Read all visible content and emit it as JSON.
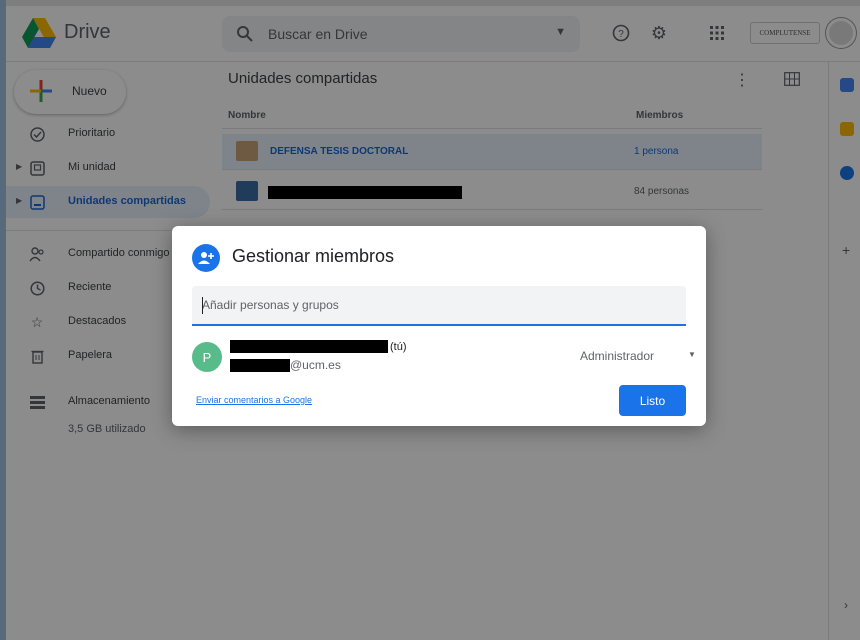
{
  "topbar": {
    "brand": "Drive",
    "search_placeholder": "Buscar en Drive",
    "org_logo_text": "COMPLUTENSE"
  },
  "sidebar": {
    "new_label": "Nuevo",
    "items": [
      {
        "label": "Prioritario",
        "icon": "check-circle-icon"
      },
      {
        "label": "Mi unidad",
        "icon": "my-drive-icon"
      },
      {
        "label": "Unidades compartidas",
        "icon": "shared-drives-icon",
        "active": true
      },
      {
        "label": "Compartido conmigo",
        "icon": "people-icon"
      },
      {
        "label": "Reciente",
        "icon": "clock-icon"
      },
      {
        "label": "Destacados",
        "icon": "star-icon"
      },
      {
        "label": "Papelera",
        "icon": "trash-icon"
      },
      {
        "label": "Almacenamiento",
        "icon": "storage-icon"
      }
    ],
    "storage_used": "3,5 GB utilizado"
  },
  "main": {
    "title": "Unidades compartidas",
    "columns": {
      "name": "Nombre",
      "members": "Miembros"
    },
    "rows": [
      {
        "name": "DEFENSA TESIS DOCTORAL",
        "members": "1 persona"
      },
      {
        "name": "",
        "members": "84 personas"
      }
    ]
  },
  "dialog": {
    "title": "Gestionar miembros",
    "add_placeholder": "Añadir personas y grupos",
    "member": {
      "initial": "P",
      "you_tag": "(tú)",
      "email_suffix": "@ucm.es",
      "role": "Administrador"
    },
    "feedback_link": "Enviar comentarios a Google",
    "done_label": "Listo"
  },
  "colors": {
    "accent": "#1a73e8",
    "selected_row": "#e8f0fe",
    "avatar": "#57bb8a"
  }
}
